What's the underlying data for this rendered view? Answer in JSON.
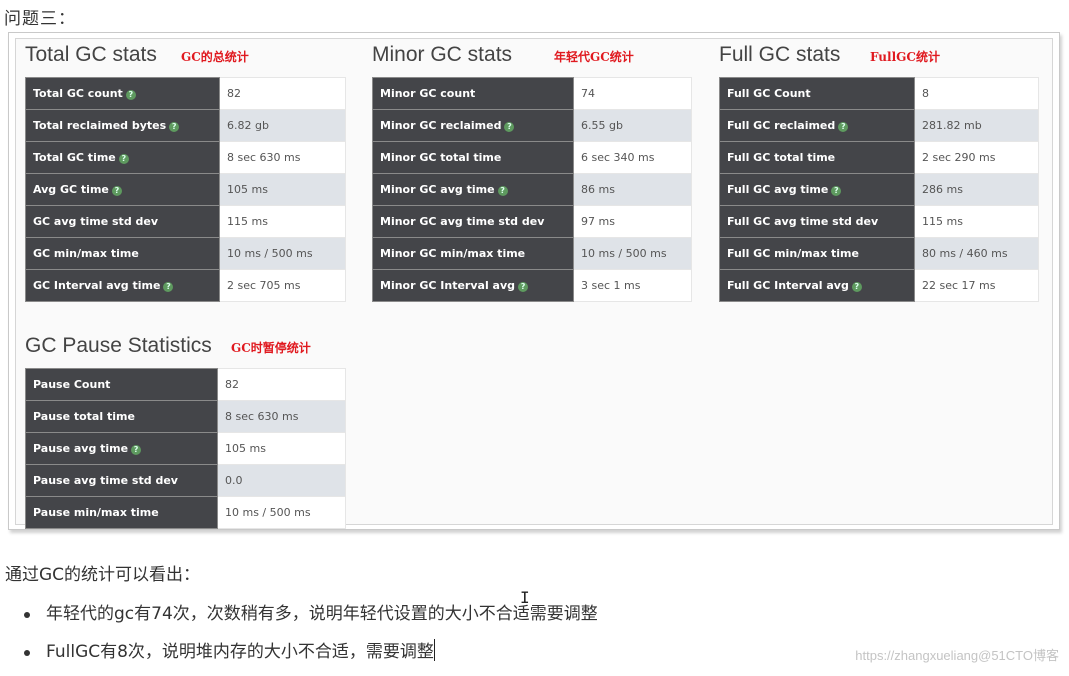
{
  "heading": "问题三：",
  "sections": {
    "total": {
      "title": "Total GC stats",
      "note": "GC的总统计",
      "rows": [
        {
          "label": "Total GC count",
          "help": true,
          "value": "82"
        },
        {
          "label": "Total reclaimed bytes",
          "help": true,
          "value": "6.82 gb"
        },
        {
          "label": "Total GC time",
          "help": true,
          "value": "8 sec 630 ms"
        },
        {
          "label": "Avg GC time",
          "help": true,
          "value": "105 ms"
        },
        {
          "label": "GC avg time std dev",
          "help": false,
          "value": "115 ms"
        },
        {
          "label": "GC min/max time",
          "help": false,
          "value": "10 ms / 500 ms"
        },
        {
          "label": "GC Interval avg time",
          "help": true,
          "value": "2 sec 705 ms"
        }
      ]
    },
    "minor": {
      "title": "Minor GC stats",
      "note": "年轻代GC统计",
      "rows": [
        {
          "label": "Minor GC count",
          "help": false,
          "value": "74"
        },
        {
          "label": "Minor GC reclaimed",
          "help": true,
          "value": "6.55 gb"
        },
        {
          "label": "Minor GC total time",
          "help": false,
          "value": "6 sec 340 ms"
        },
        {
          "label": "Minor GC avg time",
          "help": true,
          "value": "86 ms"
        },
        {
          "label": "Minor GC avg time std dev",
          "help": false,
          "value": "97 ms"
        },
        {
          "label": "Minor GC min/max time",
          "help": false,
          "value": "10 ms / 500 ms"
        },
        {
          "label": "Minor GC Interval avg",
          "help": true,
          "value": "3 sec 1 ms"
        }
      ]
    },
    "full": {
      "title": "Full GC stats",
      "note": "FullGC统计",
      "rows": [
        {
          "label": "Full GC Count",
          "help": false,
          "value": "8"
        },
        {
          "label": "Full GC reclaimed",
          "help": true,
          "value": "281.82 mb"
        },
        {
          "label": "Full GC total time",
          "help": false,
          "value": "2 sec 290 ms"
        },
        {
          "label": "Full GC avg time",
          "help": true,
          "value": "286 ms"
        },
        {
          "label": "Full GC avg time std dev",
          "help": false,
          "value": "115 ms"
        },
        {
          "label": "Full GC min/max time",
          "help": false,
          "value": "80 ms / 460 ms"
        },
        {
          "label": "Full GC Interval avg",
          "help": true,
          "value": "22 sec 17 ms"
        }
      ]
    },
    "pause": {
      "title": "GC Pause Statistics",
      "note": "GC时暂停统计",
      "rows": [
        {
          "label": "Pause Count",
          "help": false,
          "value": "82"
        },
        {
          "label": "Pause total time",
          "help": false,
          "value": "8 sec 630 ms"
        },
        {
          "label": "Pause avg time",
          "help": true,
          "value": "105 ms"
        },
        {
          "label": "Pause avg time std dev",
          "help": false,
          "value": "0.0"
        },
        {
          "label": "Pause min/max time",
          "help": false,
          "value": "10 ms / 500 ms"
        }
      ]
    }
  },
  "help_icon": {
    "name": "question-circle-icon",
    "glyph": "?",
    "color": "#5e9a5f"
  },
  "summary": "通过GC的统计可以看出：",
  "bullets": [
    "年轻代的gc有74次，次数稍有多，说明年轻代设置的大小不合适需要调整",
    "FullGC有8次，说明堆内存的大小不合适，需要调整"
  ],
  "watermark": "https://zhangxueliang@51CTO博客",
  "colors": {
    "note_red": "#e0191f",
    "key_cell_bg": "#444549",
    "alt_row_bg": "#dfe3e8"
  }
}
